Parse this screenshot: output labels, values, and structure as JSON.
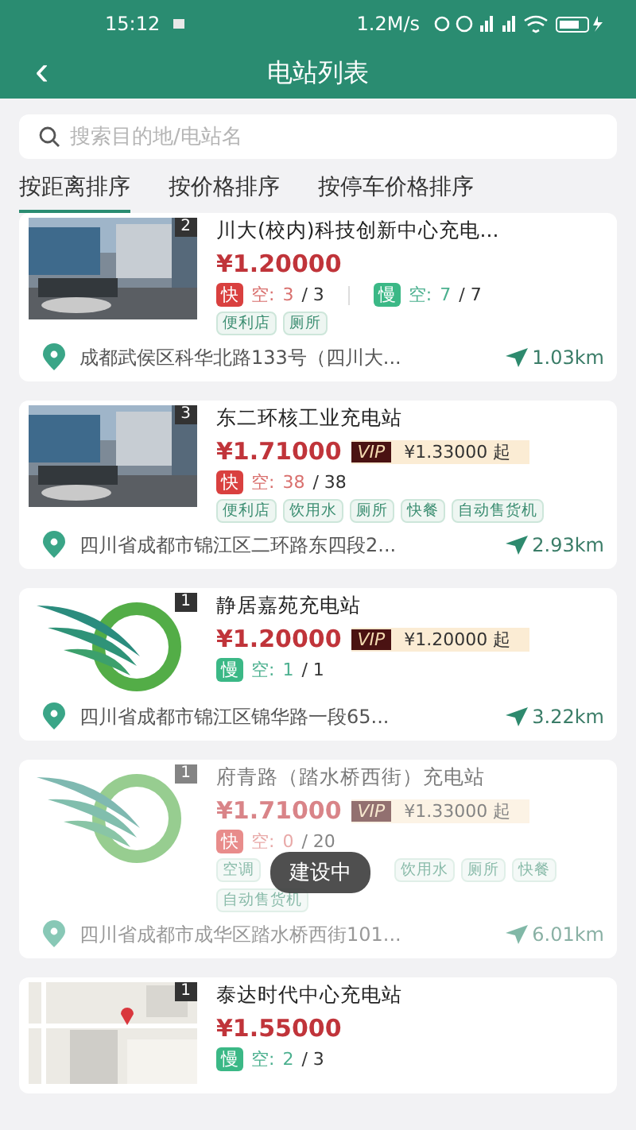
{
  "status_bar": {
    "time": "15:12",
    "speed": "1.2M/s"
  },
  "header": {
    "title": "电站列表",
    "back": "‹"
  },
  "search": {
    "placeholder": "搜索目的地/电站名"
  },
  "tabs": [
    {
      "label": "按距离排序",
      "selected": true
    },
    {
      "label": "按价格排序",
      "selected": false
    },
    {
      "label": "按停车价格排序",
      "selected": false
    }
  ],
  "stations": [
    {
      "count": "2",
      "name": "川大(校内)科技创新中心充电...",
      "price": "¥1.20000",
      "chargers": [
        {
          "kind": "fast",
          "label": "快",
          "free_label": "空:",
          "free": "3",
          "total": "/ 3"
        },
        {
          "kind": "slow",
          "label": "慢",
          "free_label": "空:",
          "free": "7",
          "total": "/ 7"
        }
      ],
      "tags": [
        "便利店",
        "厕所"
      ],
      "address": "成都武侯区科华北路133号（四川大...",
      "distance": "1.03km",
      "disabled": false
    },
    {
      "count": "3",
      "name": "东二环核工业充电站",
      "price": "¥1.71000",
      "vip": {
        "label": "VIP",
        "price": "¥1.33000 起"
      },
      "chargers": [
        {
          "kind": "fast",
          "label": "快",
          "free_label": "空:",
          "free": "38",
          "total": "/ 38"
        }
      ],
      "tags": [
        "便利店",
        "饮用水",
        "厕所",
        "快餐",
        "自动售货机"
      ],
      "address": "四川省成都市锦江区二环路东四段2...",
      "distance": "2.93km",
      "disabled": false
    },
    {
      "kind": "logo",
      "count": "1",
      "name": "静居嘉苑充电站",
      "price": "¥1.20000",
      "vip": {
        "label": "VIP",
        "price": "¥1.20000 起"
      },
      "chargers": [
        {
          "kind": "slow",
          "label": "慢",
          "free_label": "空:",
          "free": "1",
          "total": "/ 1"
        }
      ],
      "address": "四川省成都市锦江区锦华路一段65...",
      "distance": "3.22km",
      "disabled": false
    },
    {
      "kind": "logo",
      "count": "1",
      "name": "府青路（踏水桥西街）充电站",
      "price": "¥1.71000",
      "vip": {
        "label": "VIP",
        "price": "¥1.33000 起"
      },
      "chargers": [
        {
          "kind": "fast",
          "label": "快",
          "free_label": "空:",
          "free": "0",
          "total": "/ 20"
        }
      ],
      "tags": [
        "空调",
        "饮用水",
        "厕所",
        "快餐",
        "自动售货机"
      ],
      "address": "四川省成都市成华区踏水桥西街101...",
      "distance": "6.01km",
      "disabled": true,
      "toast": "建设中"
    },
    {
      "kind": "map",
      "count": "1",
      "name": "泰达时代中心充电站",
      "price": "¥1.55000",
      "chargers": [
        {
          "kind": "slow",
          "label": "慢",
          "free_label": "空:",
          "free": "2",
          "total": "/ 3"
        }
      ],
      "disabled": false
    }
  ]
}
